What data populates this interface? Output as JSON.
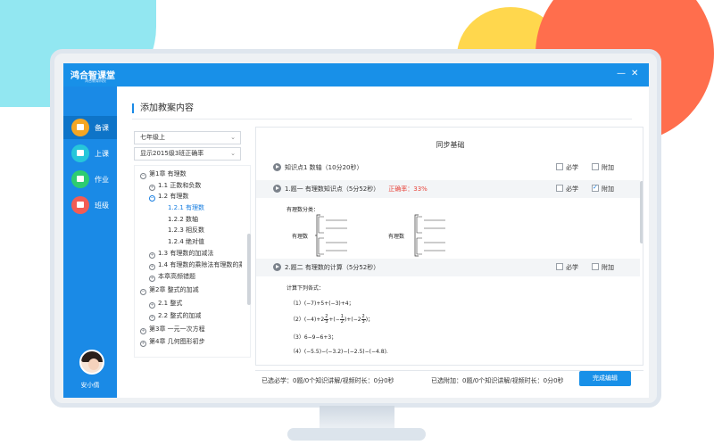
{
  "app": {
    "logo_text": "鸿合智课堂",
    "logo_sub": "鸿合教育科技",
    "minimize_glyph": "—",
    "close_glyph": "✕"
  },
  "sidebar": {
    "items": [
      {
        "label": "备课",
        "icon": "briefcase-icon",
        "color": "#f5a623",
        "active": true
      },
      {
        "label": "上课",
        "icon": "monitor-icon",
        "color": "#26c6da",
        "active": false
      },
      {
        "label": "作业",
        "icon": "book-icon",
        "color": "#2ecc71",
        "active": false
      },
      {
        "label": "班级",
        "icon": "grid-icon",
        "color": "#f25c54",
        "active": false
      }
    ],
    "user_name": "安小倩",
    "tools": [
      "edit-icon",
      "help-icon",
      "settings-icon"
    ],
    "tool_glyphs": [
      "✎",
      "?",
      "⚙"
    ]
  },
  "page": {
    "title": "添加教案内容"
  },
  "filters": {
    "grade": "七年级上",
    "class_filter": "显示2015级3班正确率",
    "caret": "⌄"
  },
  "tree": {
    "nodes": [
      {
        "text": "第1章  有理数",
        "icon": "−",
        "blue": false,
        "selected": false
      },
      {
        "text": "1.1 正数和负数",
        "icon": "+",
        "blue": false,
        "selected": false
      },
      {
        "text": "1.2 有理数",
        "icon": "−",
        "blue": true,
        "selected": false
      },
      {
        "text": "1.2.1 有理数",
        "icon": "",
        "blue": false,
        "selected": true
      },
      {
        "text": "1.2.2 数轴",
        "icon": "",
        "blue": false,
        "selected": false
      },
      {
        "text": "1.2.3 相反数",
        "icon": "",
        "blue": false,
        "selected": false
      },
      {
        "text": "1.2.4 绝对值",
        "icon": "",
        "blue": false,
        "selected": false
      },
      {
        "text": "1.3 有理数的加减法",
        "icon": "+",
        "blue": false,
        "selected": false
      },
      {
        "text": "1.4 有理数的乘除法有理数的乘...",
        "icon": "+",
        "blue": false,
        "selected": false
      },
      {
        "text": "本章高频错题",
        "icon": "+",
        "blue": false,
        "selected": false
      },
      {
        "text": "第2章  整式的加减",
        "icon": "−",
        "blue": false,
        "selected": false
      },
      {
        "text": "2.1 整式",
        "icon": "+",
        "blue": false,
        "selected": false
      },
      {
        "text": "2.2 整式的加减",
        "icon": "+",
        "blue": false,
        "selected": false
      },
      {
        "text": "第3章  一元一次方程",
        "icon": "+",
        "blue": false,
        "selected": false
      },
      {
        "text": "第4章  几何图形初步",
        "icon": "+",
        "blue": false,
        "selected": false
      }
    ]
  },
  "panel": {
    "title": "同步基础",
    "items": [
      {
        "text": "知识点1  数轴（10分20秒）",
        "rate": "",
        "required_label": "必学",
        "required": false,
        "attach_label": "附加",
        "attach": false
      },
      {
        "text": "1.题一  有理数知识点（5分52秒）",
        "rate": "正确率：33%",
        "required_label": "必学",
        "required": false,
        "attach_label": "附加",
        "attach": true
      },
      {
        "text": "2.题二  有理数的计算（5分52秒）",
        "rate": "",
        "required_label": "必学",
        "required": false,
        "attach_label": "附加",
        "attach": false
      }
    ],
    "q1": {
      "intro": "有理数分类：",
      "left_label": "有理数",
      "right_label": "有理数"
    },
    "q2": {
      "intro": "计算下列各式：",
      "lines": [
        "（1）(−7)+5+(−3)+4；",
        "（2）(−4)+2",
        "（3）6−9−6+3；",
        "（4）(−5.5)−(−3.2)−(−2.5)−(−4.8)."
      ],
      "frac_int": "2",
      "frac_a_num": "2",
      "frac_a_den": "3",
      "frac_b_num": "1",
      "frac_b_den": "2",
      "frac_c_num": "2",
      "frac_c_den": "3"
    }
  },
  "footer": {
    "required_summary": "已选必学：0题/0个知识讲解/视频时长：0分0秒",
    "attach_summary": "已选附加：0题/0个知识讲解/视频时长：0分0秒",
    "done_button": "完成编辑"
  },
  "colors": {
    "brand": "#1890e8",
    "accent_red": "#e8453c"
  }
}
